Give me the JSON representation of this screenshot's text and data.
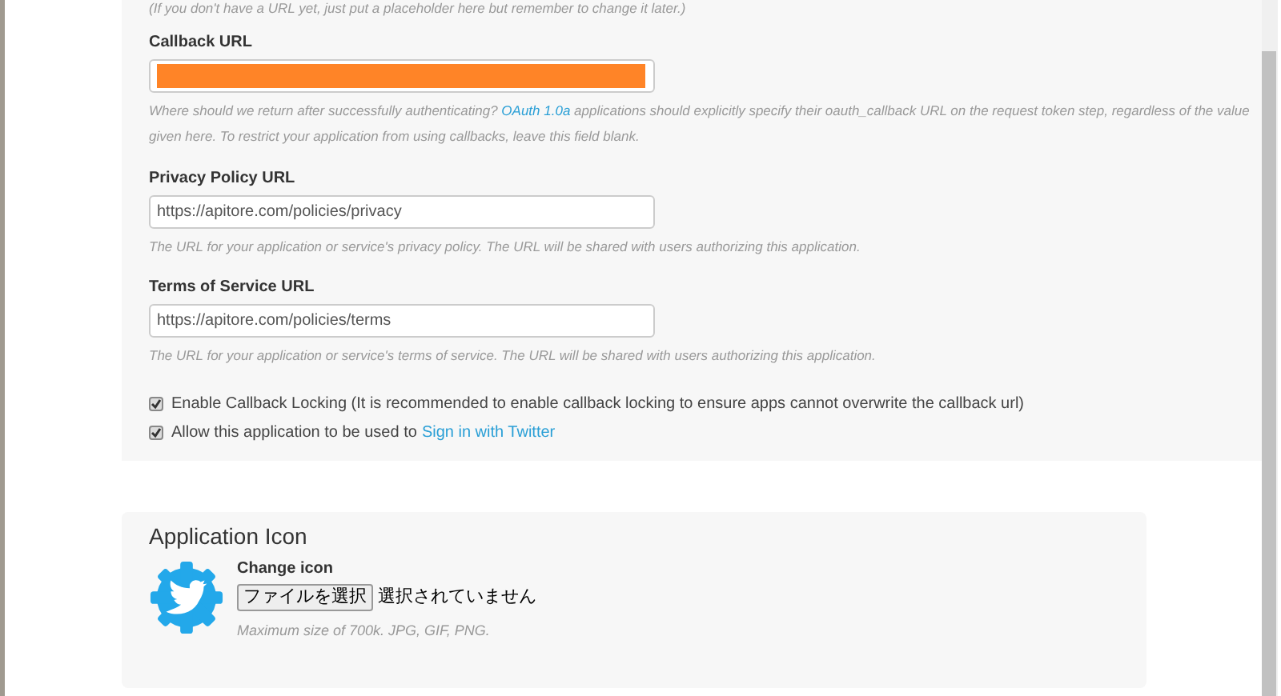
{
  "top_note": "(If you don't have a URL yet, just put a placeholder here but remember to change it later.)",
  "fields": [
    {
      "label": "Callback URL",
      "redacted": true,
      "help": "Where should we return after successfully authenticating?",
      "help_link": "OAuth 1.0a",
      "help_after": "applications should explicitly specify their oauth_callback URL on the request token step, regardless of the value given here. To restrict your application from using callbacks, leave this field blank."
    },
    {
      "label": "Privacy Policy URL",
      "value": "https://apitore.com/policies/privacy",
      "redacted": false,
      "help": "The URL for your application or service's privacy policy. The URL will be shared with users authorizing this application."
    },
    {
      "label": "Terms of Service URL",
      "value": "https://apitore.com/policies/terms",
      "redacted": false,
      "help": "The URL for your application or service's terms of service. The URL will be shared with users authorizing this application."
    }
  ],
  "checkboxes": [
    {
      "label": "Enable Callback Locking (It is recommended to enable callback locking to ensure apps cannot overwrite the callback url)",
      "checked": true
    },
    {
      "label": "Allow this application to be used to",
      "link": "Sign in with Twitter",
      "checked": true
    }
  ],
  "application_icon": {
    "title": "Application Icon",
    "label": "Change icon",
    "button": "ファイルを選択",
    "file_status": "選択されていません",
    "help": "Maximum size of 700k. JPG, GIF, PNG."
  }
}
